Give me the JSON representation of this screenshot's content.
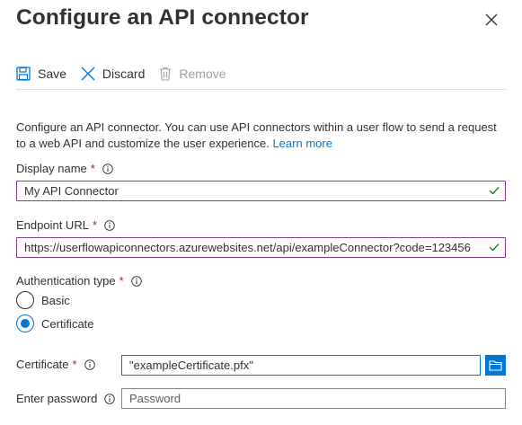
{
  "header": {
    "title": "Configure an API connector"
  },
  "toolbar": {
    "save_label": "Save",
    "discard_label": "Discard",
    "remove_label": "Remove"
  },
  "description": {
    "text": "Configure an API connector. You can use API connectors within a user flow to send a request to a web API and customize the user experience. ",
    "link": "Learn more"
  },
  "display_name": {
    "label": "Display name",
    "required": "*",
    "value": "My API Connector"
  },
  "endpoint_url": {
    "label": "Endpoint URL",
    "required": "*",
    "value": "https://userflowapiconnectors.azurewebsites.net/api/exampleConnector?code=123456"
  },
  "auth_type": {
    "label": "Authentication type",
    "required": "*",
    "options": [
      {
        "label": "Basic",
        "selected": false
      },
      {
        "label": "Certificate",
        "selected": true
      }
    ]
  },
  "certificate": {
    "label": "Certificate",
    "required": "*",
    "value": "\"exampleCertificate.pfx\""
  },
  "password": {
    "label": "Enter password",
    "placeholder": "Password"
  },
  "colors": {
    "accent": "#0078d4",
    "required": "#a4262c",
    "valid_check": "#107c10",
    "focus_border": "#8a3c8c"
  }
}
